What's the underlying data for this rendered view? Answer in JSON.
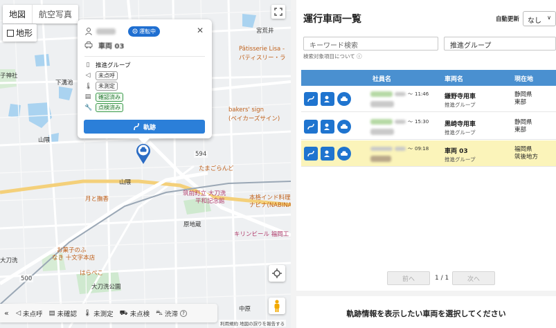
{
  "map": {
    "type_buttons": [
      "地図",
      "航空写真"
    ],
    "terrain_label": "地形",
    "labels": [
      {
        "text": "宮荒井",
        "cls": "dark"
      },
      {
        "text": "Pâtisserie Lisa -",
        "cls": "orange"
      },
      {
        "text": "パティスリー・ラ",
        "cls": "orange"
      },
      {
        "text": "子神社",
        "cls": "dark"
      },
      {
        "text": "下溝池",
        "cls": "dark"
      },
      {
        "text": "bakers' sign",
        "cls": "orange"
      },
      {
        "text": "(ベイカーズサイン)",
        "cls": "orange"
      },
      {
        "text": "山隈",
        "cls": "dark"
      },
      {
        "text": "たまごらんど",
        "cls": "orange"
      },
      {
        "text": "山隈",
        "cls": "dark"
      },
      {
        "text": "筑前町立 大刀洗",
        "cls": "pink"
      },
      {
        "text": "平和記念館",
        "cls": "pink"
      },
      {
        "text": "本格インド料理",
        "cls": "orange"
      },
      {
        "text": "ナビナ(NABINA",
        "cls": "orange"
      },
      {
        "text": "月と撫香",
        "cls": "orange"
      },
      {
        "text": "原地蔵",
        "cls": "dark"
      },
      {
        "text": "キリンビール 福岡工",
        "cls": "pink"
      },
      {
        "text": "お菓子のふ",
        "cls": "orange"
      },
      {
        "text": "なき 十文字本店",
        "cls": "orange"
      },
      {
        "text": "大刀洗",
        "cls": "dark"
      },
      {
        "text": "はらぺこ",
        "cls": "orange"
      },
      {
        "text": "大刀洗公園",
        "cls": "dark"
      },
      {
        "text": "中原",
        "cls": "dark"
      },
      {
        "text": "594",
        "cls": "white"
      },
      {
        "text": "500",
        "cls": "white"
      }
    ],
    "popup": {
      "status": "運転中",
      "vehicle_name": "車両 03",
      "group": "推進グループ",
      "tags": [
        {
          "icon": "megaphone-icon",
          "label": "未点呼",
          "style": "gray"
        },
        {
          "icon": "thermometer-icon",
          "label": "未測定",
          "style": "gray"
        },
        {
          "icon": "id-card-icon",
          "label": "確認済み",
          "style": "green"
        },
        {
          "icon": "wrench-icon",
          "label": "点検済み",
          "style": "green"
        }
      ],
      "track_button": "軌跡"
    },
    "legend": [
      {
        "icon": "megaphone-icon",
        "label": "未点呼"
      },
      {
        "icon": "id-card-icon",
        "label": "未確認"
      },
      {
        "icon": "thermometer-icon",
        "label": "未測定"
      },
      {
        "icon": "car-check-icon",
        "label": "未点検"
      },
      {
        "icon": "traffic-icon",
        "label": "渋滞"
      }
    ],
    "attribution": "利用規約  地図の誤りを報告する"
  },
  "panel": {
    "title": "運行車両一覧",
    "auto_update_label": "自動更新",
    "auto_update_value": "なし",
    "search_placeholder": "キーワード検索",
    "group_value": "推進グループ",
    "help_text": "検索対象項目について",
    "columns": [
      "社員名",
      "車両名",
      "現在地"
    ],
    "rows": [
      {
        "time_end": "11:46",
        "vehicle": "鎌野寺用車",
        "group": "推進グループ",
        "loc1": "静岡県",
        "loc2": "東部",
        "selected": false
      },
      {
        "time_end": "15:30",
        "vehicle": "黒崎寺用車",
        "group": "推進グループ",
        "loc1": "静岡県",
        "loc2": "東部",
        "selected": false
      },
      {
        "time_end": "09:18",
        "vehicle": "車両 03",
        "group": "推進グループ",
        "loc1": "福岡県",
        "loc2": "筑後地方",
        "selected": true
      }
    ],
    "pager": {
      "prev": "前へ",
      "info": "1 / 1",
      "next": "次へ"
    },
    "bottom_message": "軌跡情報を表示したい車両を選択してください"
  }
}
